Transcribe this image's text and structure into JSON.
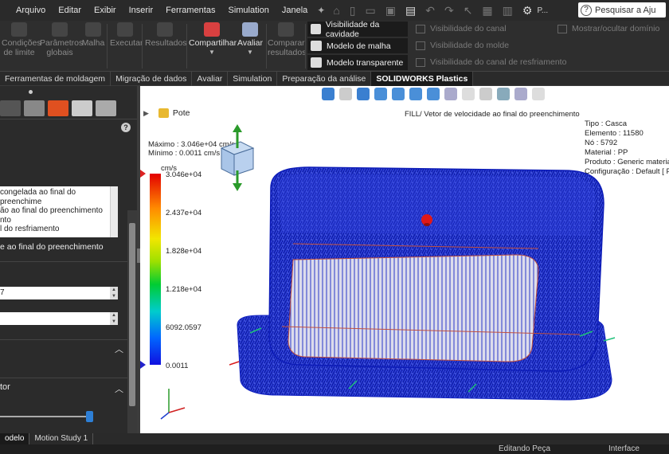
{
  "menu": {
    "items": [
      "Arquivo",
      "Editar",
      "Exibir",
      "Inserir",
      "Ferramentas",
      "Simulation",
      "Janela"
    ],
    "search_placeholder": "Pesquisar a Aju",
    "overflow": "P..."
  },
  "ribbon": {
    "buttons": [
      {
        "label1": "Condições",
        "label2": "de limite",
        "enabled": false
      },
      {
        "label1": "Parâmetros",
        "label2": "globais",
        "enabled": false
      },
      {
        "label1": "Malha",
        "label2": "",
        "enabled": false
      },
      {
        "label1": "Executar",
        "label2": "",
        "enabled": false
      },
      {
        "label1": "Resultados",
        "label2": "",
        "enabled": false
      },
      {
        "label1": "Compartilhar",
        "label2": "",
        "enabled": true
      },
      {
        "label1": "Avaliar",
        "label2": "",
        "enabled": true
      },
      {
        "label1": "Comparar",
        "label2": "resultados",
        "enabled": false
      }
    ],
    "visibility_active": [
      "Visibilidade da cavidade",
      "Modelo de malha",
      "Modelo transparente"
    ],
    "visibility_inactive": [
      "Visibilidade do canal",
      "Visibilidade do molde",
      "Visibilidade do canal de resfriamento"
    ],
    "show_hide_domain": "Mostrar/ocultar domínio"
  },
  "command_tabs": [
    "Ferramentas de moldagem",
    "Migração de dados",
    "Avaliar",
    "Simulation",
    "Preparação da análise",
    "SOLIDWORKS Plastics"
  ],
  "active_command_tab": "SOLIDWORKS Plastics",
  "left_panel": {
    "list_items": [
      "congelada ao final do preenchime",
      "ão ao final do preenchimento",
      "nto",
      "l do resfriamento"
    ],
    "selected_result": "e ao final do preenchimento",
    "spin1": "7",
    "spin2": "",
    "section_title": "tor"
  },
  "viewport": {
    "part_name": "Pote",
    "result_title": "FILL/ Vetor de velocidade ao final do preenchimento",
    "info": {
      "tipo": "Tipo : Casca",
      "elemento": "Elemento : 11580",
      "no": "Nó : 5792",
      "material": "Material : PP",
      "produto": "Produto : Generic material /",
      "configuracao": "Configuração : Default [ Pot"
    },
    "maximo": "Máximo : 3.046e+04 cm/s",
    "minimo": "Mínimo : 0.0011 cm/s",
    "unit": "cm/s",
    "legend_labels": [
      "3.046e+04",
      "2.437e+04",
      "1.828e+04",
      "1.218e+04",
      "6092.0597",
      "0.0011"
    ]
  },
  "bottom_tabs": [
    "odelo",
    "Motion Study 1"
  ],
  "active_bottom_tab": "odelo",
  "status": {
    "editing": "Editando Peça",
    "interface": "Interface simplific"
  }
}
